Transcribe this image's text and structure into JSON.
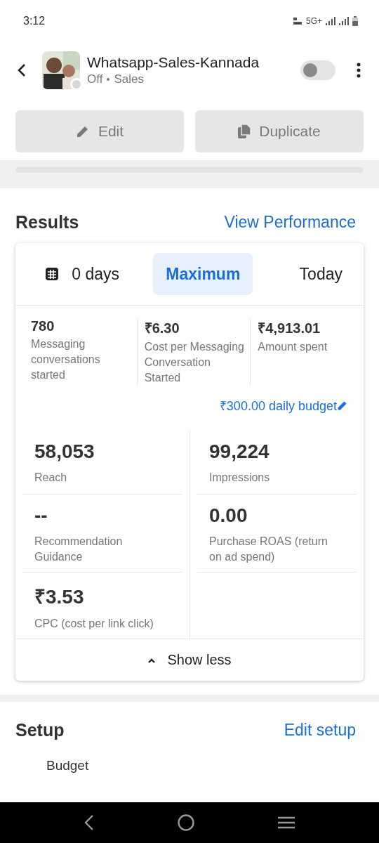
{
  "status_bar": {
    "time": "3:12",
    "network": "5G+"
  },
  "header": {
    "title": "Whatsapp-Sales-Kannada",
    "status": "Off",
    "objective": "Sales",
    "toggle": {
      "on": false
    }
  },
  "actions": [
    {
      "label": "Edit",
      "kind": "edit"
    },
    {
      "label": "Duplicate",
      "kind": "duplicate"
    }
  ],
  "results": {
    "title": "Results",
    "link": "View Performance",
    "tabs": [
      {
        "label": "0 days",
        "selected": false
      },
      {
        "label": "Maximum",
        "selected": true
      },
      {
        "label": "Today",
        "selected": false
      }
    ],
    "summary": [
      {
        "value": "780",
        "label": "Messaging conversations started"
      },
      {
        "value": "₹6.30",
        "label": "Cost per Messaging Conversation Started"
      },
      {
        "value": "₹4,913.01",
        "label": "Amount spent"
      }
    ],
    "budget_link": "₹300.00 daily budget",
    "metrics": [
      {
        "value": "58,053",
        "label": "Reach"
      },
      {
        "value": "99,224",
        "label": "Impressions"
      },
      {
        "value": "--",
        "label": "Recommendation Guidance"
      },
      {
        "value": "0.00",
        "label": "Purchase ROAS (return on ad spend)"
      },
      {
        "value": "₹3.53",
        "label": "CPC (cost per link click)"
      }
    ],
    "toggle_label": "Show less"
  },
  "setup": {
    "title": "Setup",
    "link": "Edit setup",
    "first_item": "Budget"
  }
}
